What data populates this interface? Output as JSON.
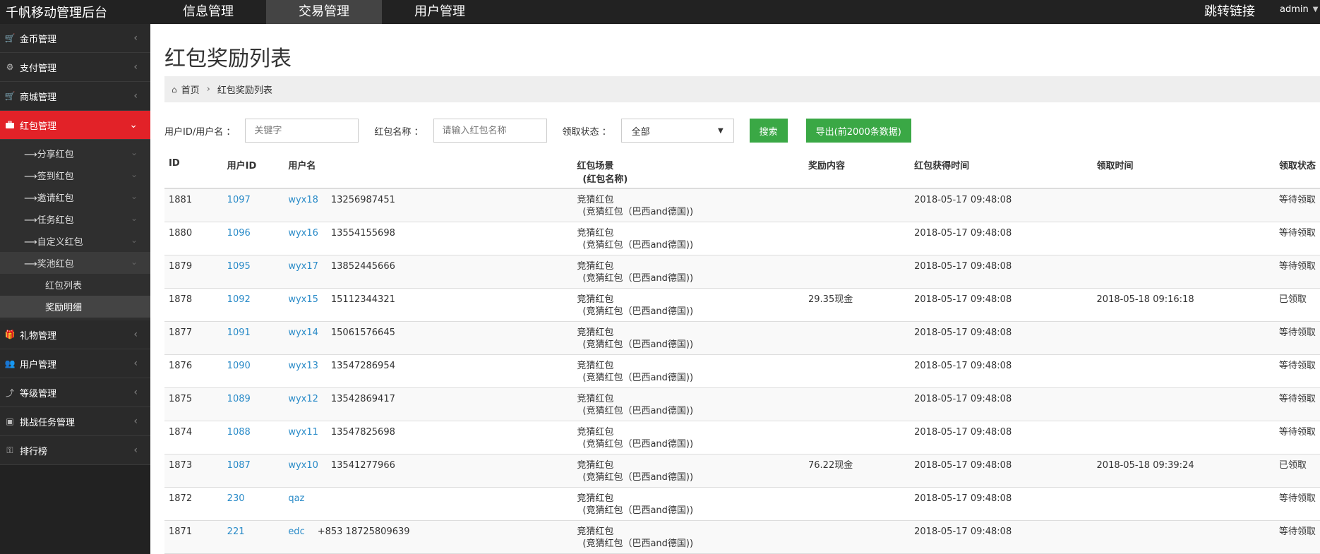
{
  "brand": "千帆移动管理后台",
  "topnav": [
    {
      "label": "信息管理",
      "active": false
    },
    {
      "label": "交易管理",
      "active": true
    },
    {
      "label": "用户管理",
      "active": false
    }
  ],
  "jump_link": "跳转链接",
  "admin": "admin",
  "sidebar": {
    "items": [
      {
        "label": "金币管理",
        "icon": "cart-icon"
      },
      {
        "label": "支付管理",
        "icon": "gears-icon"
      },
      {
        "label": "商城管理",
        "icon": "cart-icon"
      },
      {
        "label": "红包管理",
        "icon": "briefcase-icon"
      },
      {
        "label": "礼物管理",
        "icon": "gift-icon"
      },
      {
        "label": "用户管理",
        "icon": "users-icon"
      },
      {
        "label": "等级管理",
        "icon": "level-icon"
      },
      {
        "label": "挑战任务管理",
        "icon": "task-icon"
      },
      {
        "label": "排行榜",
        "icon": "sitemap-icon"
      }
    ],
    "subs": [
      "⟶分享红包",
      "⟶签到红包",
      "⟶邀请红包",
      "⟶任务红包",
      "⟶自定义红包",
      "⟶奖池红包"
    ],
    "leaves": [
      "红包列表",
      "奖励明细"
    ]
  },
  "page_title": "红包奖励列表",
  "breadcrumb": {
    "home": "首页",
    "current": "红包奖励列表"
  },
  "filters": {
    "user_label": "用户ID/用户名 ：",
    "user_placeholder": "关键字",
    "name_label": "红包名称 ：",
    "name_placeholder": "请输入红包名称",
    "status_label": "领取状态 ：",
    "status_value": "全部",
    "search_btn": "搜索",
    "export_btn": "导出(前2000条数据)"
  },
  "table": {
    "headers": {
      "id": "ID",
      "uid": "用户ID",
      "uname": "用户名",
      "scene": "红包场景",
      "scene_sub": "(红包名称)",
      "reward": "奖励内容",
      "got_time": "红包获得时间",
      "claim_time": "领取时间",
      "status": "领取状态"
    },
    "rows": [
      {
        "id": "1881",
        "uid": "1097",
        "uname": "wyx18",
        "phone": "13256987451",
        "scene": "竞猜红包",
        "scene_sub": "(竞猜红包（巴西and德国))",
        "reward": "",
        "got_time": "2018-05-17 09:48:08",
        "claim_time": "",
        "status": "等待领取"
      },
      {
        "id": "1880",
        "uid": "1096",
        "uname": "wyx16",
        "phone": "13554155698",
        "scene": "竞猜红包",
        "scene_sub": "(竞猜红包（巴西and德国))",
        "reward": "",
        "got_time": "2018-05-17 09:48:08",
        "claim_time": "",
        "status": "等待领取"
      },
      {
        "id": "1879",
        "uid": "1095",
        "uname": "wyx17",
        "phone": "13852445666",
        "scene": "竞猜红包",
        "scene_sub": "(竞猜红包（巴西and德国))",
        "reward": "",
        "got_time": "2018-05-17 09:48:08",
        "claim_time": "",
        "status": "等待领取"
      },
      {
        "id": "1878",
        "uid": "1092",
        "uname": "wyx15",
        "phone": "15112344321",
        "scene": "竞猜红包",
        "scene_sub": "(竞猜红包（巴西and德国))",
        "reward": "29.35现金",
        "got_time": "2018-05-17 09:48:08",
        "claim_time": "2018-05-18 09:16:18",
        "status": "已领取"
      },
      {
        "id": "1877",
        "uid": "1091",
        "uname": "wyx14",
        "phone": "15061576645",
        "scene": "竞猜红包",
        "scene_sub": "(竞猜红包（巴西and德国))",
        "reward": "",
        "got_time": "2018-05-17 09:48:08",
        "claim_time": "",
        "status": "等待领取"
      },
      {
        "id": "1876",
        "uid": "1090",
        "uname": "wyx13",
        "phone": "13547286954",
        "scene": "竞猜红包",
        "scene_sub": "(竞猜红包（巴西and德国))",
        "reward": "",
        "got_time": "2018-05-17 09:48:08",
        "claim_time": "",
        "status": "等待领取"
      },
      {
        "id": "1875",
        "uid": "1089",
        "uname": "wyx12",
        "phone": "13542869417",
        "scene": "竞猜红包",
        "scene_sub": "(竞猜红包（巴西and德国))",
        "reward": "",
        "got_time": "2018-05-17 09:48:08",
        "claim_time": "",
        "status": "等待领取"
      },
      {
        "id": "1874",
        "uid": "1088",
        "uname": "wyx11",
        "phone": "13547825698",
        "scene": "竞猜红包",
        "scene_sub": "(竞猜红包（巴西and德国))",
        "reward": "",
        "got_time": "2018-05-17 09:48:08",
        "claim_time": "",
        "status": "等待领取"
      },
      {
        "id": "1873",
        "uid": "1087",
        "uname": "wyx10",
        "phone": "13541277966",
        "scene": "竞猜红包",
        "scene_sub": "(竞猜红包（巴西and德国))",
        "reward": "76.22现金",
        "got_time": "2018-05-17 09:48:08",
        "claim_time": "2018-05-18 09:39:24",
        "status": "已领取"
      },
      {
        "id": "1872",
        "uid": "230",
        "uname": "qaz",
        "phone": "",
        "scene": "竞猜红包",
        "scene_sub": "(竞猜红包（巴西and德国))",
        "reward": "",
        "got_time": "2018-05-17 09:48:08",
        "claim_time": "",
        "status": "等待领取"
      },
      {
        "id": "1871",
        "uid": "221",
        "uname": "edc",
        "phone": "+853 18725809639",
        "scene": "竞猜红包",
        "scene_sub": "(竞猜红包（巴西and德国))",
        "reward": "",
        "got_time": "2018-05-17 09:48:08",
        "claim_time": "",
        "status": "等待领取"
      }
    ]
  }
}
